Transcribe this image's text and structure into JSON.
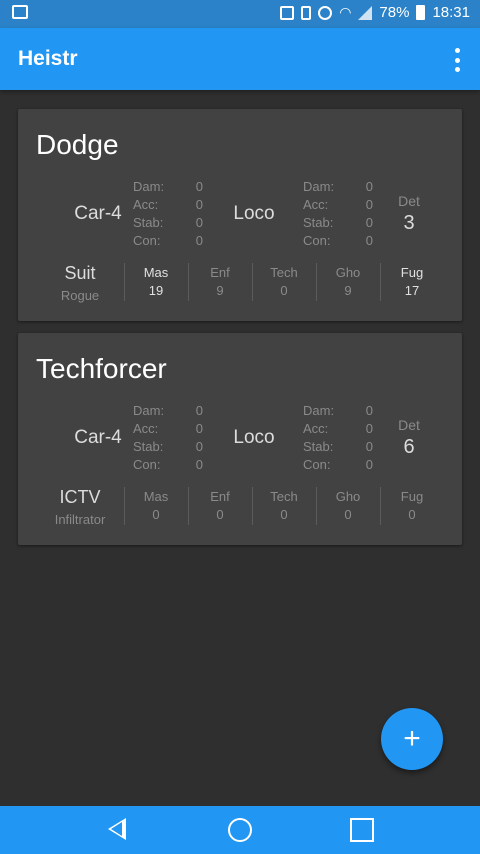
{
  "status_bar": {
    "battery": "78%",
    "time": "18:31"
  },
  "app_bar": {
    "title": "Heistr"
  },
  "stat_labels": {
    "dam": "Dam:",
    "acc": "Acc:",
    "stab": "Stab:",
    "con": "Con:",
    "det": "Det"
  },
  "skill_labels": {
    "mas": "Mas",
    "enf": "Enf",
    "tech": "Tech",
    "gho": "Gho",
    "fug": "Fug"
  },
  "crew": [
    {
      "name": "Dodge",
      "primary": {
        "name": "Car-4",
        "dam": "0",
        "acc": "0",
        "stab": "0",
        "con": "0"
      },
      "secondary": {
        "name": "Loco",
        "dam": "0",
        "acc": "0",
        "stab": "0",
        "con": "0"
      },
      "det": "3",
      "role": {
        "name": "Suit",
        "class": "Rogue"
      },
      "skills": {
        "mas": "19",
        "enf": "9",
        "tech": "0",
        "gho": "9",
        "fug": "17"
      }
    },
    {
      "name": "Techforcer",
      "primary": {
        "name": "Car-4",
        "dam": "0",
        "acc": "0",
        "stab": "0",
        "con": "0"
      },
      "secondary": {
        "name": "Loco",
        "dam": "0",
        "acc": "0",
        "stab": "0",
        "con": "0"
      },
      "det": "6",
      "role": {
        "name": "ICTV",
        "class": "Infiltrator"
      },
      "skills": {
        "mas": "0",
        "enf": "0",
        "tech": "0",
        "gho": "0",
        "fug": "0"
      }
    }
  ],
  "fab": {
    "label": "+"
  },
  "icons": {
    "status_left": "image-icon",
    "status_right": [
      "nfc-icon",
      "vibrate-icon",
      "alarm-icon",
      "wifi-icon",
      "signal-icon",
      "battery-icon"
    ],
    "menu": "more-vert-icon",
    "nav": [
      "back-icon",
      "home-icon",
      "recents-icon"
    ]
  }
}
